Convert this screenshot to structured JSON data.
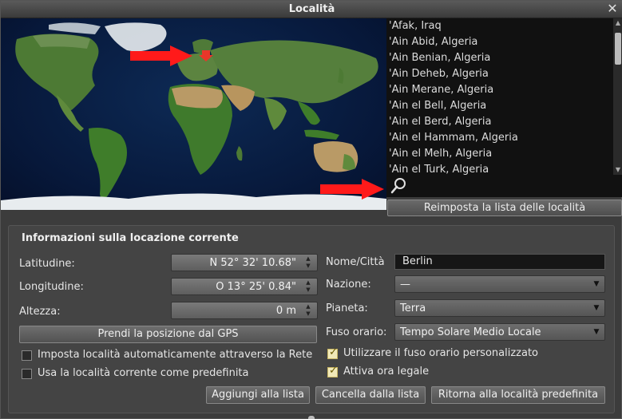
{
  "window": {
    "title": "Località"
  },
  "city_list": {
    "items": [
      "'Afak, Iraq",
      "'Ain Abid, Algeria",
      "'Ain Benian, Algeria",
      "'Ain Deheb, Algeria",
      "'Ain Merane, Algeria",
      "'Ain el Bell, Algeria",
      "'Ain el Berd, Algeria",
      "'Ain el Hammam, Algeria",
      "'Ain el Melh, Algeria",
      "'Ain el Turk, Algeria"
    ],
    "search_value": ""
  },
  "buttons": {
    "reset_list": "Reimposta la lista delle località",
    "gps": "Prendi la posizione dal GPS",
    "add_to_list": "Aggiungi alla lista",
    "delete_from_list": "Cancella dalla lista",
    "return_default": "Ritorna alla località predefinita"
  },
  "info": {
    "section_title": "Informazioni sulla locazione corrente",
    "latitude_label": "Latitudine:",
    "latitude_value": "N 52° 32' 10.68\"",
    "longitude_label": "Longitudine:",
    "longitude_value": "O 13° 25' 0.84\"",
    "altitude_label": "Altezza:",
    "altitude_value": "0 m",
    "name_label": "Nome/Città",
    "name_value": "Berlin",
    "nation_label": "Nazione:",
    "nation_value": "—",
    "planet_label": "Pianeta:",
    "planet_value": "Terra",
    "timezone_label": "Fuso orario:",
    "timezone_value": "Tempo Solare Medio Locale",
    "auto_location_label": "Imposta località automaticamente attraverso la Rete",
    "auto_location_checked": false,
    "default_location_label": "Usa la località corrente come predefinita",
    "default_location_checked": false,
    "custom_tz_label": "Utilizzare il fuso orario personalizzato",
    "custom_tz_checked": true,
    "dst_label": "Attiva ora legale",
    "dst_checked": true
  },
  "colors": {
    "arrow": "#ff1a1a",
    "marker": "#e8362a",
    "ocean": "#0a2149",
    "land": "#4d7a34",
    "desert": "#b99a66",
    "ice": "#e8ecef"
  }
}
